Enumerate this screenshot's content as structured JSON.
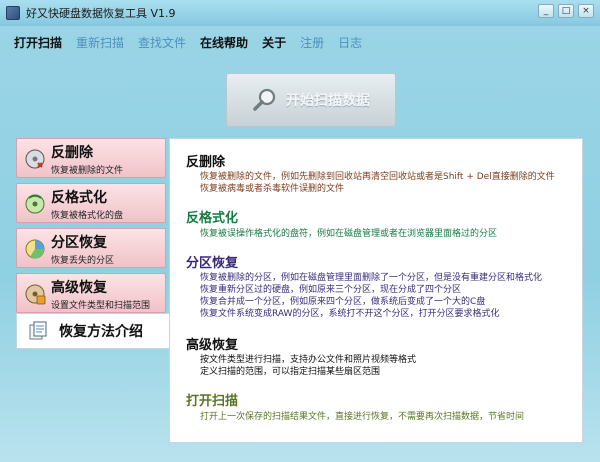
{
  "window": {
    "title": "好又快硬盘数据恢复工具 V1.9",
    "controls": [
      "_",
      "□",
      "×"
    ]
  },
  "menu": [
    {
      "label": "打开扫描",
      "enabled": true
    },
    {
      "label": "重新扫描",
      "enabled": false
    },
    {
      "label": "查找文件",
      "enabled": false
    },
    {
      "label": "在线帮助",
      "enabled": true
    },
    {
      "label": "关于",
      "enabled": true
    },
    {
      "label": "注册",
      "enabled": false
    },
    {
      "label": "日志",
      "enabled": false
    }
  ],
  "start_button": {
    "label": "开始扫描数据",
    "enabled": false
  },
  "sidebar": {
    "items": [
      {
        "title": "反删除",
        "subtitle": "恢复被删除的文件"
      },
      {
        "title": "反格式化",
        "subtitle": "恢复被格式化的盘"
      },
      {
        "title": "分区恢复",
        "subtitle": "恢复丢失的分区"
      },
      {
        "title": "高级恢复",
        "subtitle": "设置文件类型和扫描范围"
      }
    ],
    "active": {
      "title": "恢复方法介绍"
    }
  },
  "content": {
    "sections": [
      {
        "title": "反删除",
        "lines": [
          "恢复被删除的文件，例如先删除到回收站再清空回收站或者是Shift + Del直接删除的文件",
          "恢复被病毒或者杀毒软件误删的文件"
        ]
      },
      {
        "title": "反格式化",
        "lines": [
          "恢复被误操作格式化的盘符，例如在磁盘管理或者在浏览器里面格过的分区"
        ]
      },
      {
        "title": "分区恢复",
        "lines": [
          "恢复被删除的分区，例如在磁盘管理里面删除了一个分区，但是没有重建分区和格式化",
          "恢复重新分区过的硬盘，例如原来三个分区，现在分成了四个分区",
          "恢复合并成一个分区，例如原来四个分区，做系统后变成了一个大的C盘",
          "恢复文件系统变成RAW的分区，系统打不开这个分区，打开分区要求格式化"
        ]
      },
      {
        "title": "高级恢复",
        "lines": [
          "按文件类型进行扫描，支持办公文件和照片视频等格式",
          "定义扫描的范围，可以指定扫描某些扇区范围"
        ]
      },
      {
        "title": "打开扫描",
        "lines": [
          "打开上一次保存的扫描结果文件，直接进行恢复，不需要再次扫描数据，节省时间"
        ]
      }
    ]
  }
}
